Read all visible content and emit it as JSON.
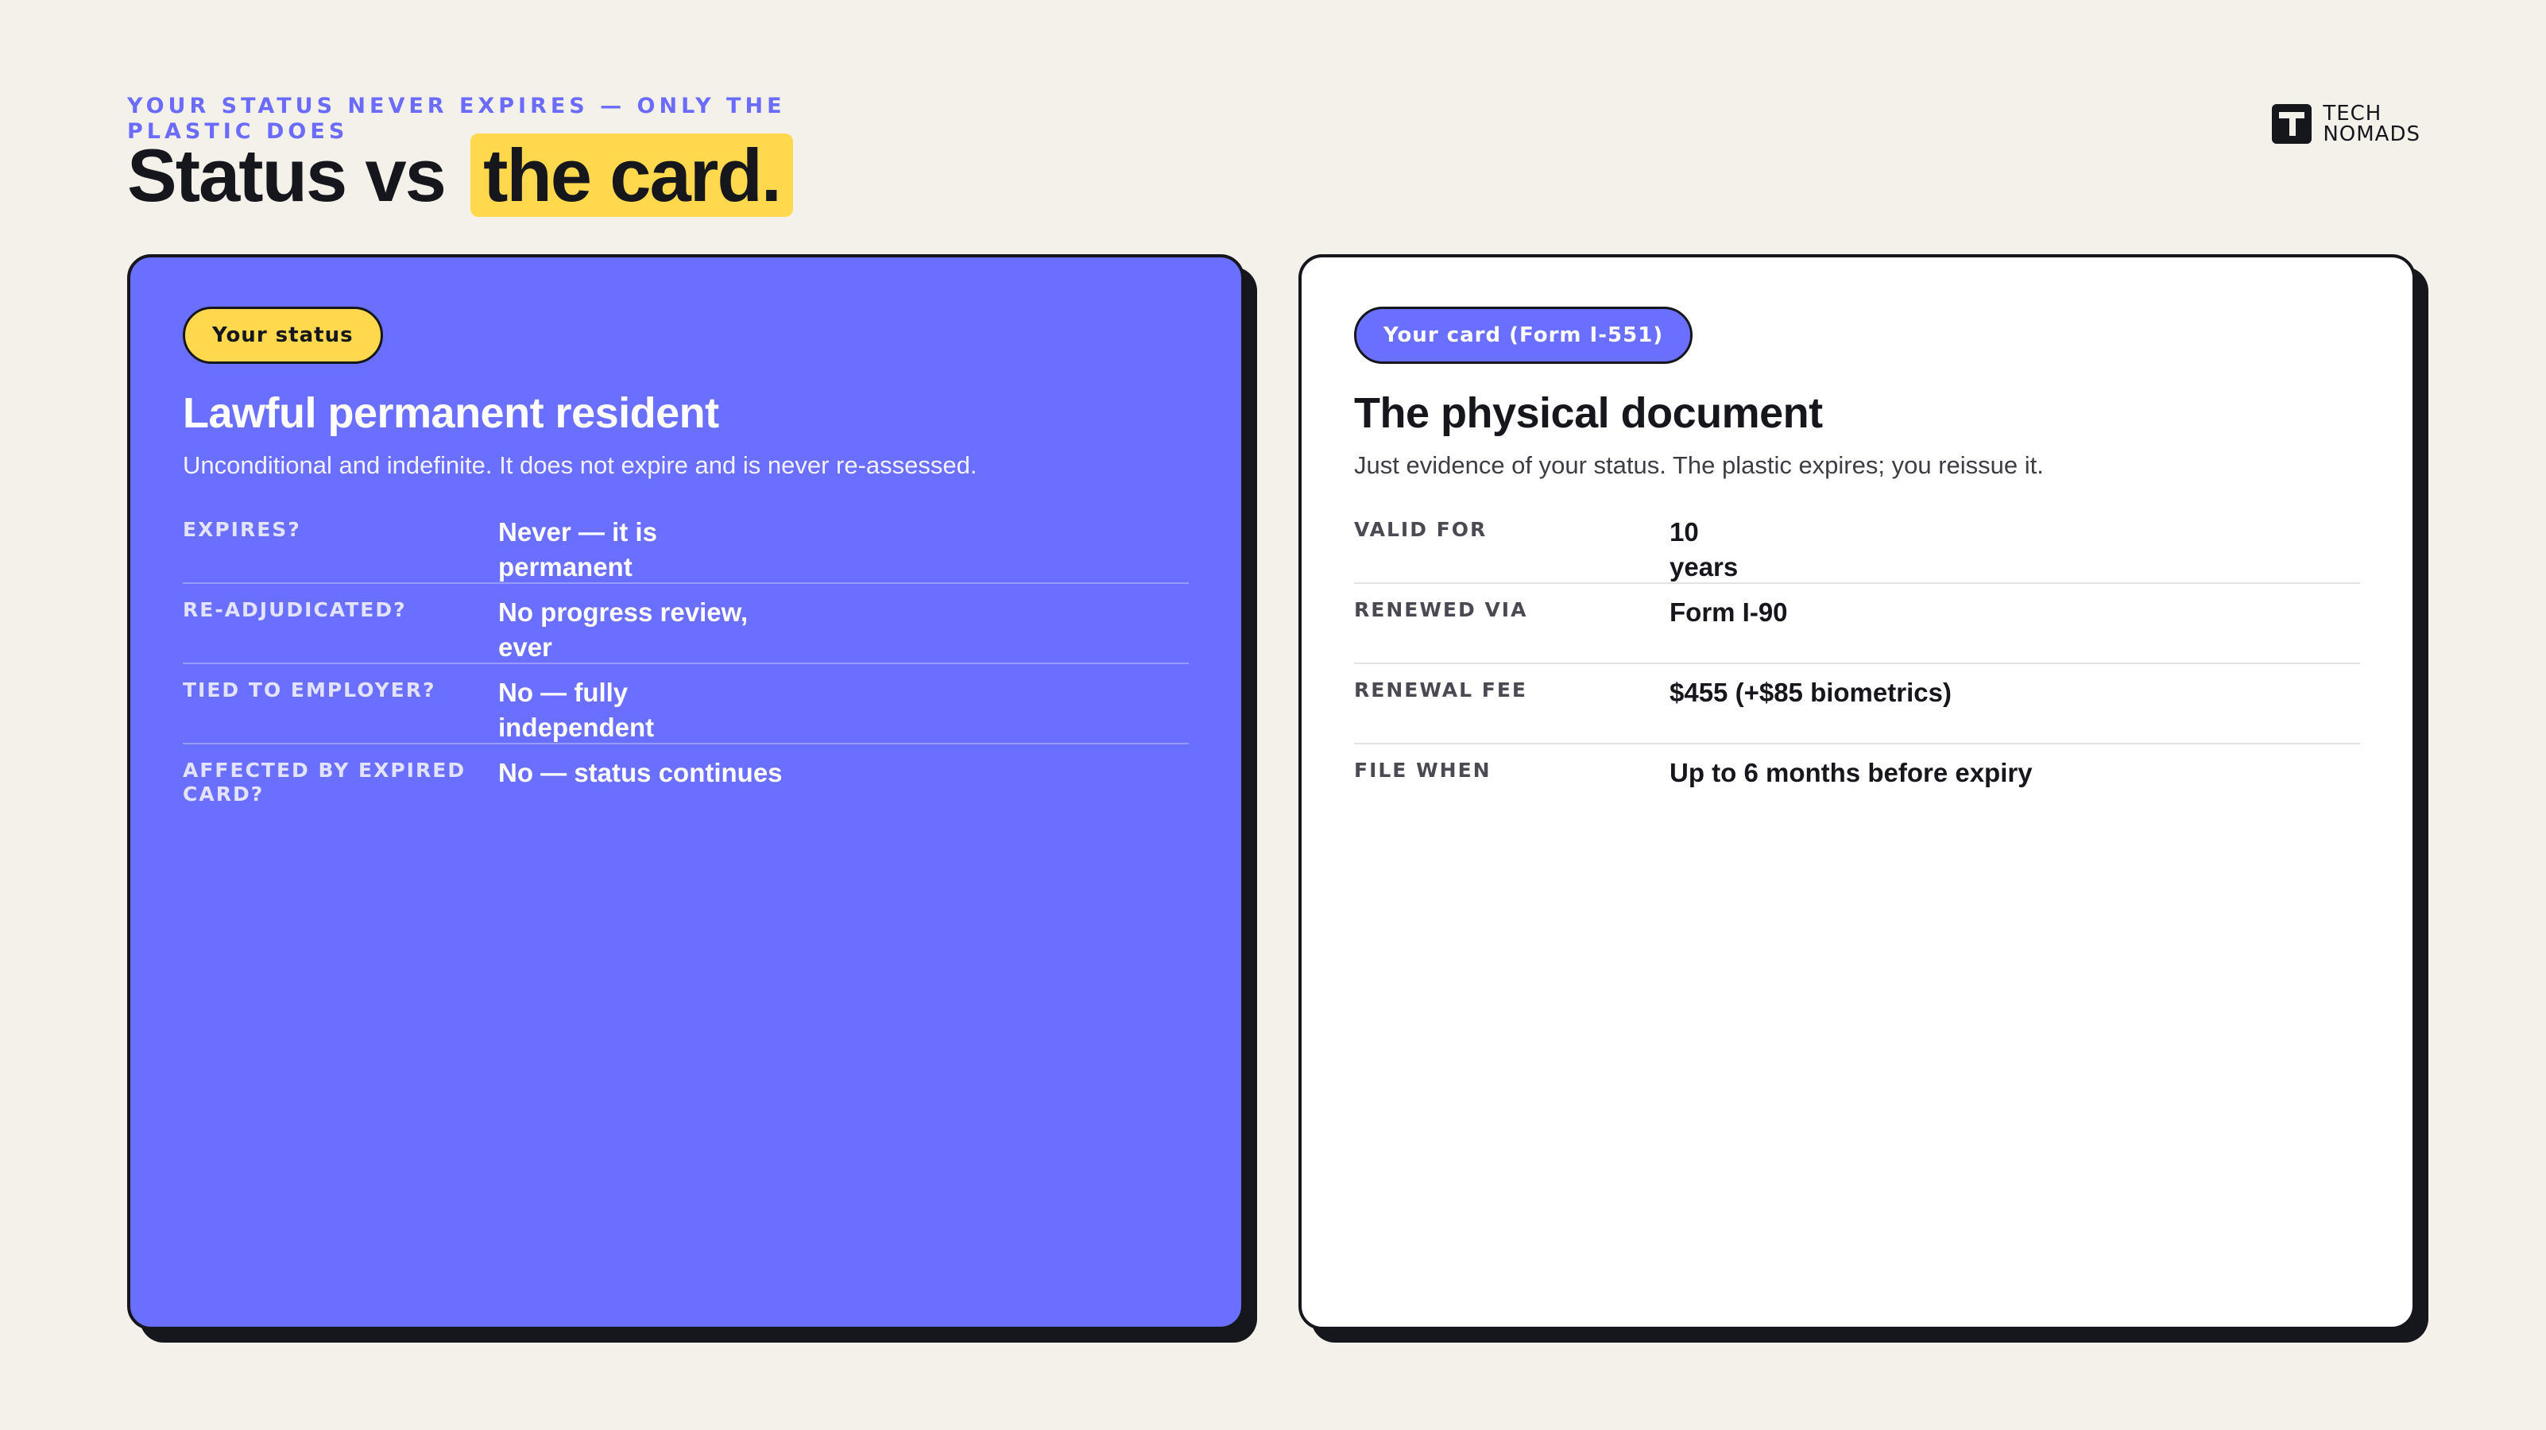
{
  "header": {
    "eyebrow": "YOUR STATUS NEVER EXPIRES — ONLY THE PLASTIC DOES",
    "title_plain": "Status vs",
    "title_highlight": "the card."
  },
  "brand": {
    "line1": "TECH",
    "line2": "NOMADS",
    "logo_icon": "tech-nomads-logo"
  },
  "colors": {
    "background": "#f4f1ea",
    "accent_purple": "#6b6fff",
    "accent_yellow": "#ffd84d",
    "ink": "#16161d"
  },
  "status_card": {
    "tag": "Your status",
    "heading": "Lawful permanent resident",
    "description": "Unconditional and indefinite. It does not expire and is never re-assessed.",
    "rows": [
      {
        "label": "EXPIRES?",
        "value": "Never — it is permanent"
      },
      {
        "label": "RE-ADJUDICATED?",
        "value": "No progress review, ever"
      },
      {
        "label": "TIED TO EMPLOYER?",
        "value": "No — fully independent"
      },
      {
        "label": "AFFECTED BY EXPIRED CARD?",
        "value": "No — status continues"
      }
    ]
  },
  "document_card": {
    "tag": "Your card (Form I-551)",
    "heading": "The physical document",
    "description": "Just evidence of your status. The plastic expires; you reissue it.",
    "rows": [
      {
        "label": "VALID FOR",
        "value": "10 years"
      },
      {
        "label": "RENEWED VIA",
        "value": "Form I-90"
      },
      {
        "label": "RENEWAL FEE",
        "value": "$455 (+$85 biometrics)"
      },
      {
        "label": "FILE WHEN",
        "value": "Up to 6 months before expiry"
      }
    ]
  }
}
